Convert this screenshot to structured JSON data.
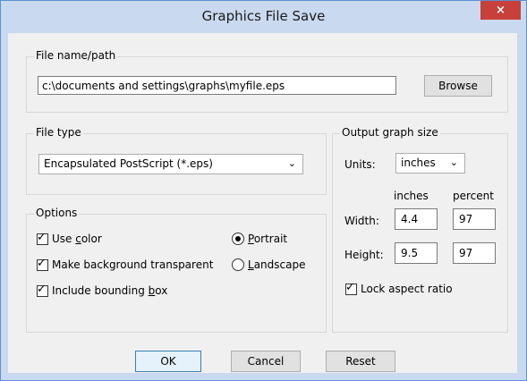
{
  "window": {
    "title": "Graphics File Save",
    "close_glyph": "×"
  },
  "file_group": {
    "legend": "File name/path",
    "path_value": "c:\\documents and settings\\graphs\\myfile.eps",
    "browse_label": "Browse"
  },
  "filetype_group": {
    "legend": "File type",
    "selected": "Encapsulated PostScript (*.eps)"
  },
  "options_group": {
    "legend": "Options",
    "use_color_prefix": "Use ",
    "use_color_ul": "c",
    "use_color_suffix": "olor",
    "use_color_checked": true,
    "transparent_label": "Make background transparent",
    "transparent_checked": true,
    "bbox_prefix": "Include bounding ",
    "bbox_ul": "b",
    "bbox_suffix": "ox",
    "bbox_checked": true,
    "portrait_ul": "P",
    "portrait_rest": "ortrait",
    "portrait_selected": true,
    "landscape_ul": "L",
    "landscape_rest": "andscape",
    "landscape_selected": false
  },
  "output_group": {
    "legend": "Output graph size",
    "units_label": "Units:",
    "units_value": "inches",
    "col_inches": "inches",
    "col_percent": "percent",
    "width_label": "Width:",
    "width_inches": "4.4",
    "width_percent": "97",
    "height_label": "Height:",
    "height_inches": "9.5",
    "height_percent": "97",
    "lock_label": "Lock aspect ratio",
    "lock_checked": true
  },
  "buttons": {
    "ok": "OK",
    "cancel": "Cancel",
    "reset": "Reset"
  },
  "colors": {
    "title_bg": "#c9d9ef",
    "close_bg": "#c7413a",
    "dialog_bg": "#f0f0f0",
    "border_accent": "#5b8fd4"
  }
}
